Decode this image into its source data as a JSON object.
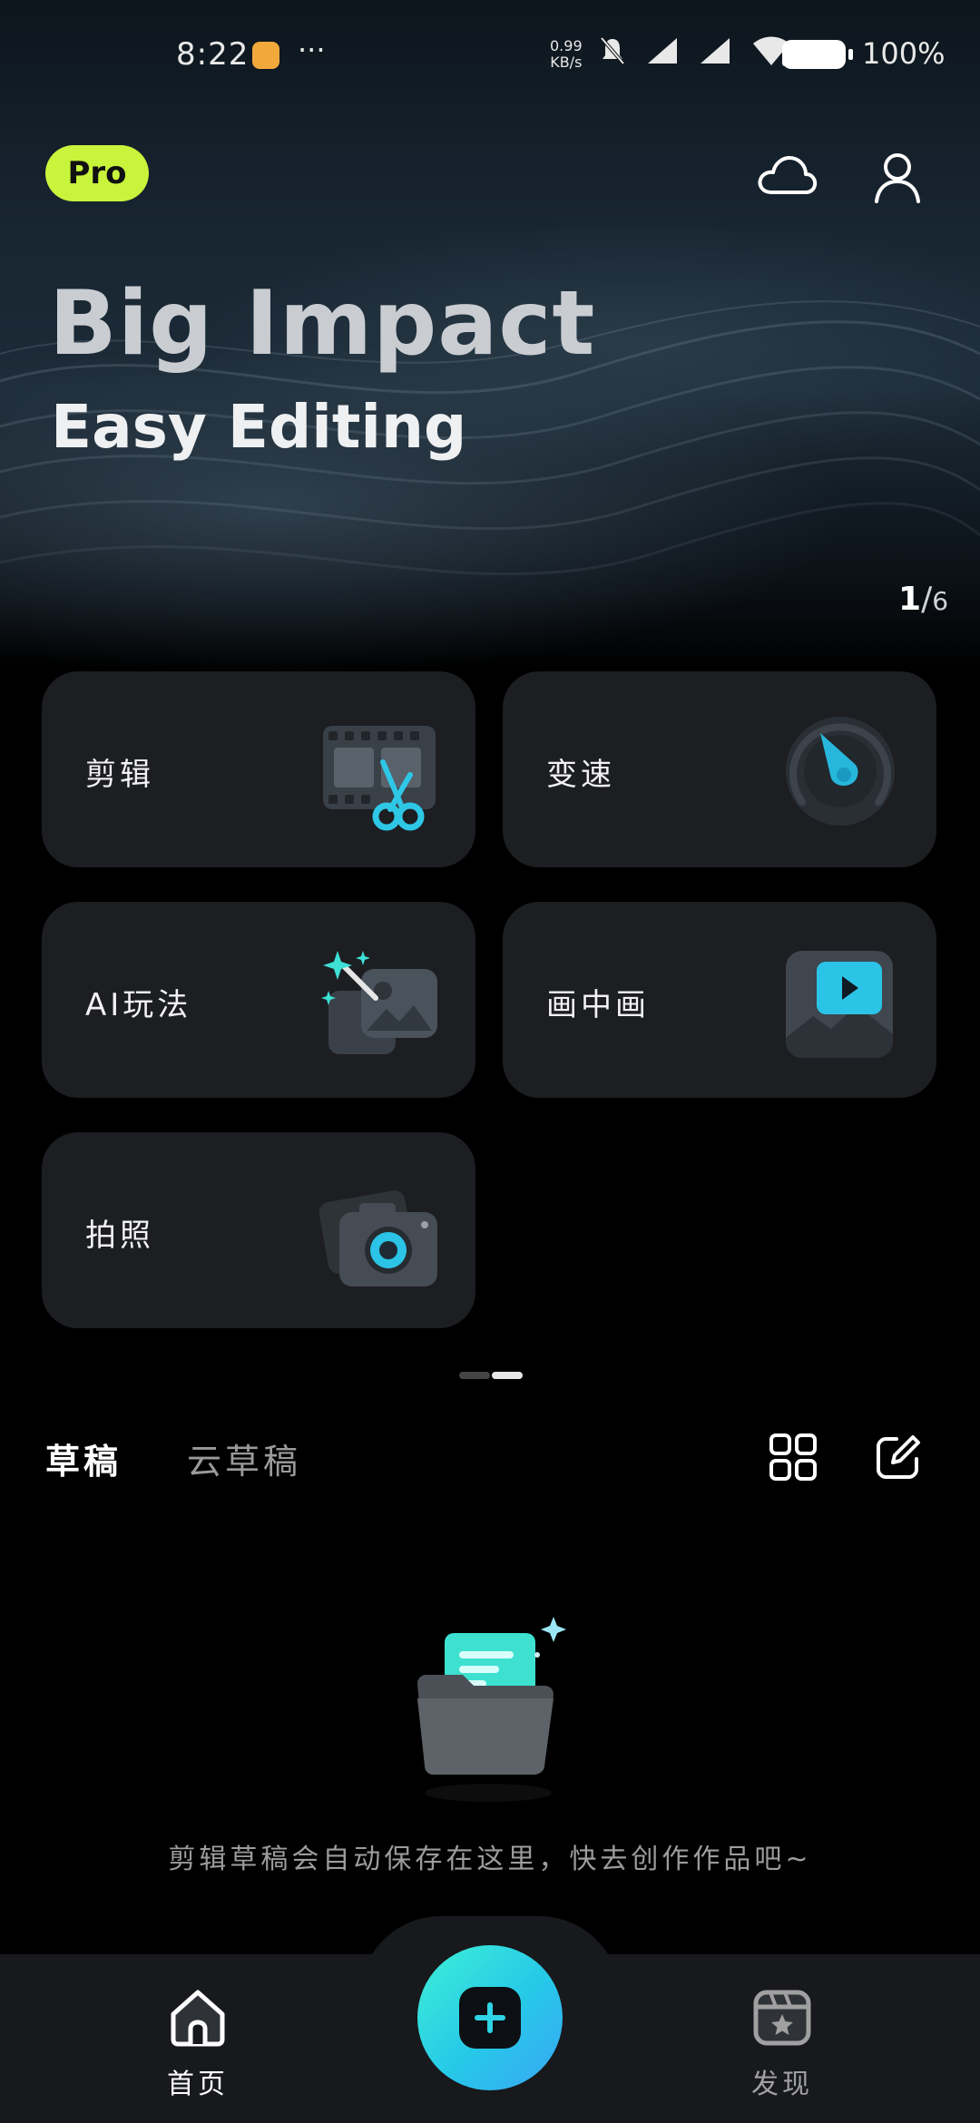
{
  "status_bar": {
    "time": "8:22",
    "more": "···",
    "speed_value": "0.99",
    "speed_unit": "KB/s",
    "wifi_band": "6",
    "battery": "100%"
  },
  "header": {
    "pro_badge": "Pro",
    "cloud_icon": "cloud-icon",
    "profile_icon": "user-icon"
  },
  "banner": {
    "title": "Big Impact",
    "subtitle": "Easy Editing",
    "current_page": "1",
    "page_total": "6",
    "current_slide": 1
  },
  "tools": [
    {
      "label": "剪辑",
      "icon": "film-scissors-icon"
    },
    {
      "label": "变速",
      "icon": "speedometer-icon"
    },
    {
      "label": "AI玩法",
      "icon": "ai-magic-image-icon"
    },
    {
      "label": "画中画",
      "icon": "picture-in-picture-icon"
    },
    {
      "label": "拍照",
      "icon": "camera-icon"
    }
  ],
  "drafts": {
    "tab_drafts": "草稿",
    "tab_cloud_drafts": "云草稿",
    "grid_icon": "grid-view-icon",
    "edit_icon": "edit-icon",
    "empty_message": "剪辑草稿会自动保存在这里，快去创作作品吧~"
  },
  "bottom_nav": {
    "home_label": "首页",
    "discover_label": "发现",
    "create_icon": "plus-icon"
  },
  "colors": {
    "pro_badge": "#c8f43b",
    "accent": "#26c8e8",
    "tile_bg": "#1c1e22"
  }
}
